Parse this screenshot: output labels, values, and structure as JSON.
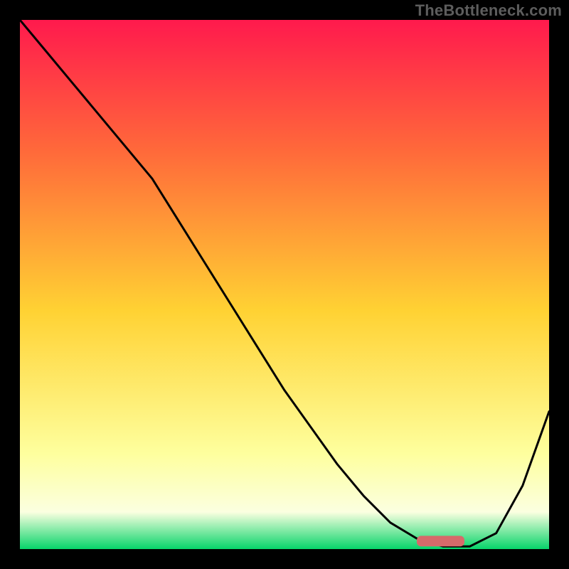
{
  "watermark": "TheBottleneck.com",
  "colors": {
    "page_bg": "#000000",
    "gradient_top": "#ff1a4d",
    "gradient_mid1": "#ff6a3a",
    "gradient_mid2": "#ffd233",
    "gradient_low": "#feff9e",
    "gradient_pale": "#fbffe0",
    "gradient_bottom": "#07d46a",
    "curve": "#000000",
    "marker": "#d76a6a",
    "watermark": "#5d5d5d"
  },
  "chart_data": {
    "type": "line",
    "title": "",
    "xlabel": "",
    "ylabel": "",
    "xlim": [
      0,
      100
    ],
    "ylim": [
      0,
      100
    ],
    "grid": false,
    "legend": false,
    "background_gradient": {
      "stops": [
        {
          "pos": 0.0,
          "color": "#ff1a4d"
        },
        {
          "pos": 0.25,
          "color": "#ff6a3a"
        },
        {
          "pos": 0.55,
          "color": "#ffd233"
        },
        {
          "pos": 0.82,
          "color": "#feff9e"
        },
        {
          "pos": 0.93,
          "color": "#fbffe0"
        },
        {
          "pos": 1.0,
          "color": "#07d46a"
        }
      ]
    },
    "x": [
      0,
      5,
      10,
      15,
      20,
      25,
      30,
      35,
      40,
      45,
      50,
      55,
      60,
      65,
      70,
      75,
      80,
      85,
      90,
      95,
      100
    ],
    "values": [
      100,
      94,
      88,
      82,
      76,
      70,
      62,
      54,
      46,
      38,
      30,
      23,
      16,
      10,
      5,
      2,
      0.5,
      0.5,
      3,
      12,
      26
    ],
    "marker": {
      "x_start": 75,
      "x_end": 84,
      "y": 0.5,
      "height": 2
    }
  }
}
